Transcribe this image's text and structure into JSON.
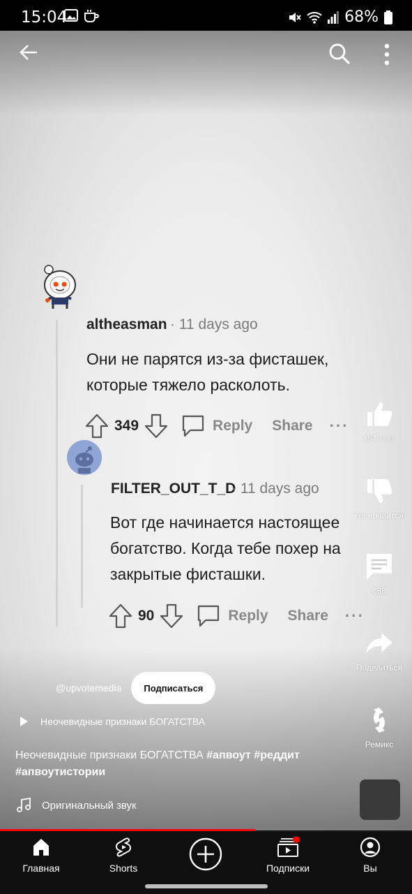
{
  "status_bar": {
    "time": "15:04",
    "battery": "68%",
    "icons": [
      "image-icon",
      "coffee-icon",
      "mute-icon",
      "wifi-icon",
      "signal-icon",
      "battery-icon"
    ]
  },
  "top_bar": {
    "icons": [
      "back-arrow-icon",
      "search-icon",
      "more-vert-icon"
    ]
  },
  "comment": {
    "username": "altheasman",
    "meta": "· 11 days ago",
    "body_line1": "Они не парятся из-за фисташек,",
    "body_line2": "которые тяжело расколоть.",
    "votes": "349",
    "reply_label": "Reply",
    "share_label": "Share",
    "more": "···"
  },
  "reply": {
    "username": "FILTER_OUT_T_D",
    "meta": "· 11 days ago",
    "body_line1": "Вот где начинается настоящее",
    "body_line2": "богатство. Когда тебе похер на",
    "body_line3": "закрытые фисташки.",
    "votes": "90",
    "reply_label": "Reply",
    "share_label": "Share",
    "more": "···"
  },
  "rail": {
    "like_count": "197 тыс.",
    "dislike_label": "Не нравится",
    "comments_count": "688",
    "share_label": "Поделиться",
    "remix_label": "Ремикс"
  },
  "channel": {
    "handle": "@upvotemedia",
    "subscribe_label": "Подписаться"
  },
  "playlist": {
    "label": "Неочевидные признаки БОГАТСТВА"
  },
  "video": {
    "title": "Неочевидные признаки БОГАТСТВА",
    "tag1": "#апвоут",
    "tag2": "#реддит",
    "tag3": "#апвоутистории",
    "progress": 0.62
  },
  "sound": {
    "label": "Оригинальный звук"
  },
  "nav": {
    "home": "Главная",
    "shorts": "Shorts",
    "subscriptions": "Подписки",
    "you": "Вы"
  },
  "colors": {
    "accent": "#ff0000",
    "nav_bg": "#0f0f0f",
    "reddit_orange": "#ff4500"
  }
}
